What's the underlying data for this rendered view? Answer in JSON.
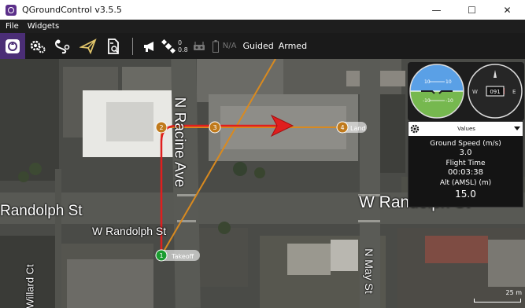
{
  "window": {
    "title": "QGroundControl v3.5.5",
    "minimize_glyph": "—",
    "maximize_glyph": "☐",
    "close_glyph": "✕"
  },
  "menu": {
    "items": [
      "File",
      "Widgets"
    ]
  },
  "toolbar": {
    "gps_count": "0",
    "gps_hdop": "0.8",
    "battery_text": "N/A",
    "flight_mode": "Guided",
    "armed_status": "Armed",
    "icons": [
      "qgc-logo-icon",
      "settings-gear-icon",
      "plan-route-icon",
      "fly-paper-plane-icon",
      "analyze-document-icon",
      "megaphone-messages-icon",
      "satellite-gps-icon",
      "rc-transmitter-icon",
      "battery-icon"
    ]
  },
  "map": {
    "streets": {
      "racine": "N Racine Ave",
      "randolph_left": "Randolph St",
      "randolph_center": "W Randolph St",
      "randolph_right": "W Randolph St",
      "may": "N May St",
      "willard": "Willard Ct"
    },
    "waypoints": [
      {
        "seq": "1",
        "label": "Takeoff",
        "color": "#1a9c2f"
      },
      {
        "seq": "2",
        "label": "",
        "color": "#c07a1c"
      },
      {
        "seq": "3",
        "label": "",
        "color": "#c07a1c"
      },
      {
        "seq": "4",
        "label": "Land",
        "color": "#c07a1c"
      }
    ],
    "scale_label": "25 m"
  },
  "instruments": {
    "compass_heading": "091",
    "compass_west": "W",
    "compass_east": "E",
    "pitch_labels": [
      "10",
      "10",
      "-10",
      "-10"
    ]
  },
  "values_panel": {
    "title": "Values",
    "items": [
      {
        "label": "Ground Speed (m/s)",
        "value": "3.0"
      },
      {
        "label": "Flight Time",
        "value": "00:03:38"
      },
      {
        "label": "Alt (AMSL) (m)",
        "value": "15.0"
      }
    ]
  },
  "colors": {
    "toolbar_active": "#4b2e76",
    "flight_path": "#e01e1e",
    "mission_line": "#d98a1f",
    "sky": "#5aa0e6",
    "ground": "#76b84f"
  }
}
